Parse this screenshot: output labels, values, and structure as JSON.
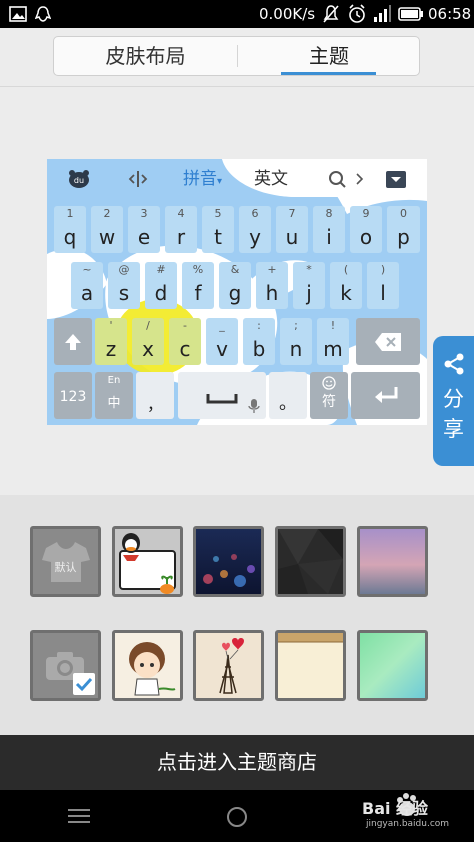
{
  "status_bar": {
    "speed": "0.00K/s",
    "time": "06:58"
  },
  "tabs": [
    {
      "label": "皮肤布局",
      "selected": false
    },
    {
      "label": "主题",
      "selected": true
    }
  ],
  "keyboard_preview": {
    "toolbar": {
      "pinyin_label": "拼音",
      "english_label": "英文"
    },
    "row1": [
      {
        "hint": "1",
        "ch": "q"
      },
      {
        "hint": "2",
        "ch": "w"
      },
      {
        "hint": "3",
        "ch": "e"
      },
      {
        "hint": "4",
        "ch": "r"
      },
      {
        "hint": "5",
        "ch": "t"
      },
      {
        "hint": "6",
        "ch": "y"
      },
      {
        "hint": "7",
        "ch": "u"
      },
      {
        "hint": "8",
        "ch": "i"
      },
      {
        "hint": "9",
        "ch": "o"
      },
      {
        "hint": "0",
        "ch": "p"
      }
    ],
    "row2": [
      {
        "hint": "~",
        "ch": "a"
      },
      {
        "hint": "@",
        "ch": "s"
      },
      {
        "hint": "#",
        "ch": "d"
      },
      {
        "hint": "%",
        "ch": "f"
      },
      {
        "hint": "&",
        "ch": "g"
      },
      {
        "hint": "+",
        "ch": "h"
      },
      {
        "hint": "*",
        "ch": "j"
      },
      {
        "hint": "(",
        "ch": "k"
      },
      {
        "hint": ")",
        "ch": "l"
      }
    ],
    "row3": [
      {
        "hint": "'",
        "ch": "z"
      },
      {
        "hint": "/",
        "ch": "x"
      },
      {
        "hint": "-",
        "ch": "c"
      },
      {
        "hint": "_",
        "ch": "v"
      },
      {
        "hint": ":",
        "ch": "b"
      },
      {
        "hint": ";",
        "ch": "n"
      },
      {
        "hint": "!",
        "ch": "m"
      }
    ],
    "num_key": "123",
    "lang_key_top": "En",
    "lang_key_bottom": "中",
    "comma_key": "，",
    "period_key": "。",
    "symbol_key": "符"
  },
  "share_label": "分享",
  "default_theme_label": "默认",
  "store_button": "点击进入主题商店",
  "watermark": {
    "brand": "Bai 经验",
    "url": "jingyan.baidu.com"
  },
  "colors": {
    "accent": "#3b8fd4",
    "key": "#b8dbf4",
    "highlight": "#f2ea23"
  }
}
